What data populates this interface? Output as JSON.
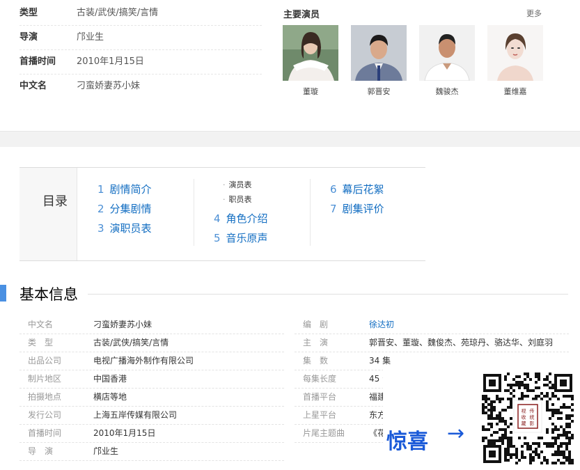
{
  "summary": [
    {
      "key": "类型",
      "value": "古装/武侠/搞笑/言情"
    },
    {
      "key": "导演",
      "value": "邝业生"
    },
    {
      "key": "首播时间",
      "value": "2010年1月15日"
    },
    {
      "key": "中文名",
      "value": "刁蛮娇妻苏小妹"
    }
  ],
  "cast": {
    "title": "主要演员",
    "more": "更多",
    "members": [
      {
        "name": "董璇"
      },
      {
        "name": "郭晋安"
      },
      {
        "name": "魏骏杰"
      },
      {
        "name": "董维嘉"
      }
    ]
  },
  "toc": {
    "label": "目录",
    "items": [
      {
        "num": "1",
        "label": "剧情简介"
      },
      {
        "num": "2",
        "label": "分集剧情"
      },
      {
        "num": "3",
        "label": "演职员表"
      },
      {
        "num": "4",
        "label": "角色介绍"
      },
      {
        "num": "5",
        "label": "音乐原声"
      },
      {
        "num": "6",
        "label": "幕后花絮"
      },
      {
        "num": "7",
        "label": "剧集评价"
      }
    ],
    "subitems": [
      "演员表",
      "职员表"
    ]
  },
  "basic_info": {
    "title": "基本信息",
    "left": [
      {
        "key": "中文名",
        "value": "刁蛮娇妻苏小妹"
      },
      {
        "key": "类　型",
        "value": "古装/武侠/搞笑/言情"
      },
      {
        "key": "出品公司",
        "value": "电视广播海外制作有限公司"
      },
      {
        "key": "制片地区",
        "value": "中国香港"
      },
      {
        "key": "拍摄地点",
        "value": "横店等地"
      },
      {
        "key": "发行公司",
        "value": "上海五岸传媒有限公司"
      },
      {
        "key": "首播时间",
        "value": "2010年1月15日"
      },
      {
        "key": "导　演",
        "value": "邝业生"
      }
    ],
    "right": [
      {
        "key": "编　剧",
        "value": "徐达初"
      },
      {
        "key": "主　演",
        "value": "郭晋安、董璇、魏俊杰、苑琼丹、骆达华、刘庭羽"
      },
      {
        "key": "集　数",
        "value": "34 集"
      },
      {
        "key": "每集长度",
        "value": "45 分"
      },
      {
        "key": "首播平台",
        "value": "福建"
      },
      {
        "key": "上星平台",
        "value": "东方"
      },
      {
        "key": "片尾主题曲",
        "value": "《花"
      }
    ]
  },
  "overlay": {
    "surprise_text": "惊喜",
    "arrow": "→",
    "qr_label": "传统影视收藏"
  }
}
